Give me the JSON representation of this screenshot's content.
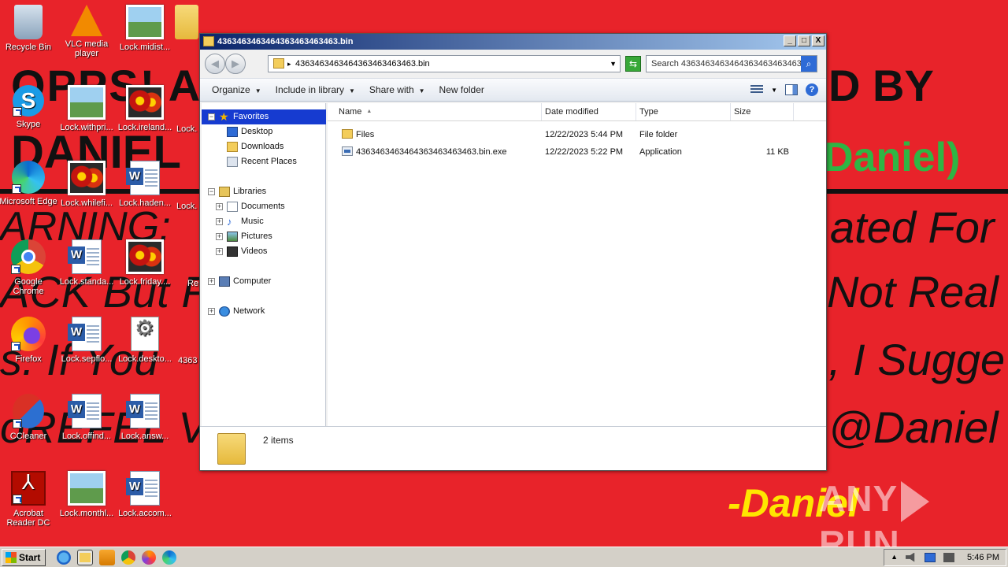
{
  "wallpaper": {
    "lines": [
      "OPPS! A",
      "DANIEL",
      "ARNING:",
      "ACK But F",
      "s. If You",
      "oREFEL V"
    ],
    "right_lines": [
      "D BY",
      "ated For",
      "Not Real",
      ", I Sugge",
      "@Daniel"
    ],
    "green_text": "Daniel)",
    "signature": "-Daniel",
    "watermark_left": "ANY",
    "watermark_right": "RUN"
  },
  "desktop_icons": [
    {
      "label": "Recycle Bin",
      "icon": "recycle-bin-icon"
    },
    {
      "label": "VLC media player",
      "icon": "vlc-icon"
    },
    {
      "label": "Lock.midist...",
      "icon": "image-file-icon"
    },
    {
      "label": "Skype",
      "icon": "skype-icon"
    },
    {
      "label": "Lock.withpri...",
      "icon": "image-file-icon"
    },
    {
      "label": "Lock.ireland...",
      "icon": "image-file-icon"
    },
    {
      "label": "Microsoft Edge",
      "icon": "edge-icon"
    },
    {
      "label": "Lock.whilefi...",
      "icon": "image-file-icon"
    },
    {
      "label": "Lock.haden...",
      "icon": "word-doc-icon"
    },
    {
      "label": "Google Chrome",
      "icon": "chrome-icon"
    },
    {
      "label": "Lock.standa...",
      "icon": "word-doc-icon"
    },
    {
      "label": "Lock.friday....",
      "icon": "image-file-icon"
    },
    {
      "label": "Firefox",
      "icon": "firefox-icon"
    },
    {
      "label": "Lock.sepflo...",
      "icon": "word-doc-icon"
    },
    {
      "label": "Lock.deskto...",
      "icon": "settings-file-icon"
    },
    {
      "label": "CCleaner",
      "icon": "ccleaner-icon"
    },
    {
      "label": "Lock.offind...",
      "icon": "word-doc-icon"
    },
    {
      "label": "Lock.answ...",
      "icon": "word-doc-icon"
    },
    {
      "label": "Acrobat Reader DC",
      "icon": "acrobat-icon"
    },
    {
      "label": "Lock.monthl...",
      "icon": "image-file-icon"
    },
    {
      "label": "Lock.accom...",
      "icon": "word-doc-icon"
    }
  ],
  "partial_icons": {
    "col4_row2": "Lock.",
    "col4_row3": "Lock.",
    "col4_row4": "Re",
    "col4_row5": "4363"
  },
  "window": {
    "title": "4363463463464363463463463.bin",
    "address": "4363463463464363463463463.bin",
    "search_placeholder": "Search 4363463463464363463463463...",
    "commands": [
      "Organize",
      "Include in library",
      "Share with",
      "New folder"
    ],
    "minimize": "_",
    "maximize": "□",
    "close": "X"
  },
  "nav_tree": {
    "favorites": "Favorites",
    "desktop": "Desktop",
    "downloads": "Downloads",
    "recent": "Recent Places",
    "libraries": "Libraries",
    "documents": "Documents",
    "music": "Music",
    "pictures": "Pictures",
    "videos": "Videos",
    "computer": "Computer",
    "network": "Network"
  },
  "columns": {
    "name": "Name",
    "date": "Date modified",
    "type": "Type",
    "size": "Size"
  },
  "files": [
    {
      "name": "Files",
      "date": "12/22/2023 5:44 PM",
      "type": "File folder",
      "size": ""
    },
    {
      "name": "4363463463464363463463463.bin.exe",
      "date": "12/22/2023 5:22 PM",
      "type": "Application",
      "size": "11 KB"
    }
  ],
  "details": {
    "items": "2 items"
  },
  "taskbar": {
    "start": "Start",
    "time": "5:46 PM"
  }
}
